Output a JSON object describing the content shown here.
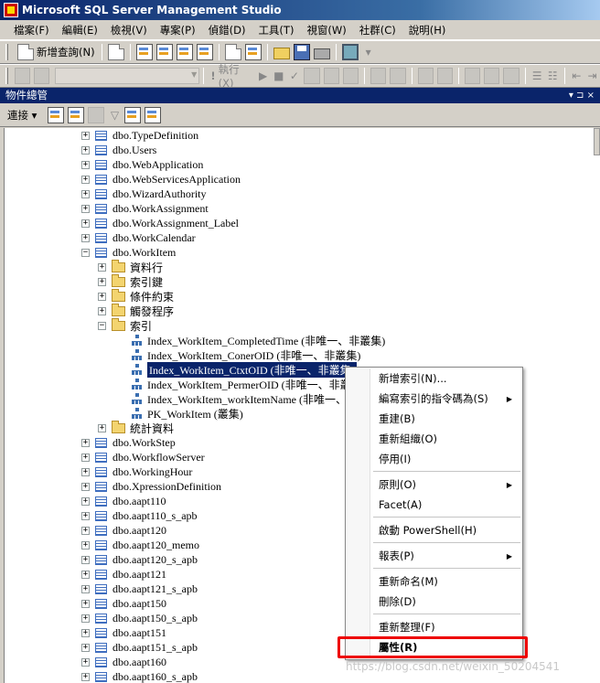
{
  "window": {
    "title": "Microsoft SQL Server Management Studio"
  },
  "menubar": {
    "items": [
      "檔案(F)",
      "編輯(E)",
      "檢視(V)",
      "專案(P)",
      "偵錯(D)",
      "工具(T)",
      "視窗(W)",
      "社群(C)",
      "說明(H)"
    ]
  },
  "toolbar": {
    "new_query": "新增查詢(N)",
    "execute": "執行(X)"
  },
  "object_explorer": {
    "title": "物件總管",
    "connect": "連接",
    "header_controls": "▾ ⊐ ×"
  },
  "tree": {
    "nodes": [
      {
        "label": "dbo.TypeDefinition",
        "kind": "table",
        "expander": "+"
      },
      {
        "label": "dbo.Users",
        "kind": "table",
        "expander": "+"
      },
      {
        "label": "dbo.WebApplication",
        "kind": "table",
        "expander": "+"
      },
      {
        "label": "dbo.WebServicesApplication",
        "kind": "table",
        "expander": "+"
      },
      {
        "label": "dbo.WizardAuthority",
        "kind": "table",
        "expander": "+"
      },
      {
        "label": "dbo.WorkAssignment",
        "kind": "table",
        "expander": "+"
      },
      {
        "label": "dbo.WorkAssignment_Label",
        "kind": "table",
        "expander": "+"
      },
      {
        "label": "dbo.WorkCalendar",
        "kind": "table",
        "expander": "+"
      },
      {
        "label": "dbo.WorkItem",
        "kind": "table",
        "expander": "−"
      },
      {
        "label": "資料行",
        "kind": "folder",
        "expander": "+"
      },
      {
        "label": "索引鍵",
        "kind": "folder",
        "expander": "+"
      },
      {
        "label": "條件約束",
        "kind": "folder",
        "expander": "+"
      },
      {
        "label": "觸發程序",
        "kind": "folder",
        "expander": "+"
      },
      {
        "label": "索引",
        "kind": "folder",
        "expander": "−"
      },
      {
        "label": "Index_WorkItem_CompletedTime (非唯一、非叢集)",
        "kind": "index"
      },
      {
        "label": "Index_WorkItem_ConerOID (非唯一、非叢集)",
        "kind": "index"
      },
      {
        "label": "Index_WorkItem_CtxtOID (非唯一、非叢集)",
        "kind": "index",
        "selected": true
      },
      {
        "label": "Index_WorkItem_PermerOID (非唯一、非叢",
        "kind": "index"
      },
      {
        "label": "Index_WorkItem_workItemName (非唯一、非",
        "kind": "index"
      },
      {
        "label": "PK_WorkItem (叢集)",
        "kind": "index"
      },
      {
        "label": "統計資料",
        "kind": "folder",
        "expander": "+"
      },
      {
        "label": "dbo.WorkStep",
        "kind": "table",
        "expander": "+"
      },
      {
        "label": "dbo.WorkflowServer",
        "kind": "table",
        "expander": "+"
      },
      {
        "label": "dbo.WorkingHour",
        "kind": "table",
        "expander": "+"
      },
      {
        "label": "dbo.XpressionDefinition",
        "kind": "table",
        "expander": "+"
      },
      {
        "label": "dbo.aapt110",
        "kind": "table",
        "expander": "+"
      },
      {
        "label": "dbo.aapt110_s_apb",
        "kind": "table",
        "expander": "+"
      },
      {
        "label": "dbo.aapt120",
        "kind": "table",
        "expander": "+"
      },
      {
        "label": "dbo.aapt120_memo",
        "kind": "table",
        "expander": "+"
      },
      {
        "label": "dbo.aapt120_s_apb",
        "kind": "table",
        "expander": "+"
      },
      {
        "label": "dbo.aapt121",
        "kind": "table",
        "expander": "+"
      },
      {
        "label": "dbo.aapt121_s_apb",
        "kind": "table",
        "expander": "+"
      },
      {
        "label": "dbo.aapt150",
        "kind": "table",
        "expander": "+"
      },
      {
        "label": "dbo.aapt150_s_apb",
        "kind": "table",
        "expander": "+"
      },
      {
        "label": "dbo.aapt151",
        "kind": "table",
        "expander": "+"
      },
      {
        "label": "dbo.aapt151_s_apb",
        "kind": "table",
        "expander": "+"
      },
      {
        "label": "dbo.aapt160",
        "kind": "table",
        "expander": "+"
      },
      {
        "label": "dbo.aapt160_s_apb",
        "kind": "table",
        "expander": "+"
      }
    ]
  },
  "context_menu": {
    "items": [
      {
        "label": "新增索引(N)...",
        "submenu": false
      },
      {
        "label": "編寫索引的指令碼為(S)",
        "submenu": true
      },
      {
        "label": "重建(B)",
        "submenu": false
      },
      {
        "label": "重新組織(O)",
        "submenu": false
      },
      {
        "label": "停用(I)",
        "submenu": false
      },
      {
        "sep": true
      },
      {
        "label": "原則(O)",
        "submenu": true
      },
      {
        "label": "Facet(A)",
        "submenu": false
      },
      {
        "sep": true
      },
      {
        "label": "啟動 PowerShell(H)",
        "submenu": false
      },
      {
        "sep": true
      },
      {
        "label": "報表(P)",
        "submenu": true
      },
      {
        "sep": true
      },
      {
        "label": "重新命名(M)",
        "submenu": false
      },
      {
        "label": "刪除(D)",
        "submenu": false
      },
      {
        "sep": true
      },
      {
        "label": "重新整理(F)",
        "submenu": false
      },
      {
        "label": "屬性(R)",
        "submenu": false,
        "highlighted": true
      }
    ]
  },
  "watermark": "https://blog.csdn.net/weixin_50204541",
  "colors": {
    "title_bar": "#0a246a",
    "selection": "#0a246a",
    "highlight_box": "#e00000"
  }
}
